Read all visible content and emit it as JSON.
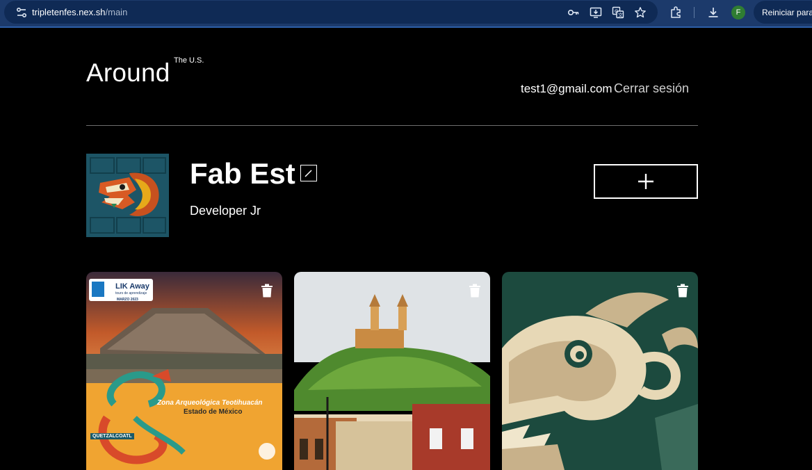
{
  "browser": {
    "url_host": "tripletenfes.nex.sh",
    "url_path": "/main",
    "profile_initial": "F",
    "restart_label": "Reiniciar para"
  },
  "header": {
    "logo": "Around",
    "logo_sup": "The U.S.",
    "email": "test1@gmail.com",
    "logout": "Cerrar sesión"
  },
  "profile": {
    "name": "Fab Est",
    "job": "Developer Jr"
  },
  "cards": [
    {
      "overlay": {
        "badge": "LIK Away",
        "badge_sub": "tours de aprendizaje",
        "date": "MARZO 2023",
        "zone": "Zona Arqueológica",
        "site": "Teotihuacán",
        "state": "Estado de México",
        "tag": "QUETZALCOATL"
      }
    },
    {},
    {}
  ],
  "colors": {
    "background": "#000000",
    "browser_bar": "#1c3a6b",
    "omnibox": "#0f2a55",
    "text": "#ffffff",
    "muted": "#cfcfcf"
  }
}
